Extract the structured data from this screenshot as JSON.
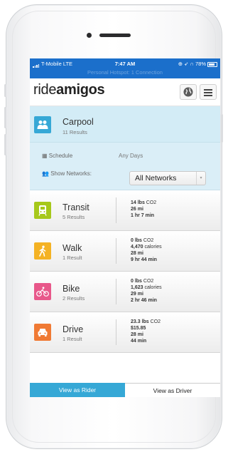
{
  "status_bar": {
    "carrier": "T-Mobile",
    "network": "LTE",
    "time": "7:47 AM",
    "battery": "78%",
    "hotspot": "Personal Hotspot: 1 Connection"
  },
  "header": {
    "logo_light": "ride",
    "logo_bold": "amigos"
  },
  "carpool": {
    "title": "Carpool",
    "results": "11 Results",
    "color": "#36a8d6"
  },
  "options": {
    "schedule_label": "Schedule",
    "schedule_value": "Any Days",
    "networks_label": "Show Networks:",
    "networks_selected": "All Networks"
  },
  "modes": [
    {
      "title": "Transit",
      "results": "5 Results",
      "color": "#a6c81a",
      "icon": "bus-icon",
      "stats": [
        {
          "bold": "14 lbs",
          "rest": " CO2"
        },
        {
          "bold": "26 mi",
          "rest": ""
        },
        {
          "bold": "1 hr 7 min",
          "rest": ""
        }
      ]
    },
    {
      "title": "Walk",
      "results": "1 Result",
      "color": "#f4b223",
      "icon": "walk-icon",
      "stats": [
        {
          "bold": "0 lbs",
          "rest": " CO2"
        },
        {
          "bold": "4,470",
          "rest": " calories"
        },
        {
          "bold": "28 mi",
          "rest": ""
        },
        {
          "bold": "9 hr 44 min",
          "rest": ""
        }
      ]
    },
    {
      "title": "Bike",
      "results": "2 Results",
      "color": "#e8588a",
      "icon": "bike-icon",
      "stats": [
        {
          "bold": "0 lbs",
          "rest": " CO2"
        },
        {
          "bold": "1,623",
          "rest": " calories"
        },
        {
          "bold": "29 mi",
          "rest": ""
        },
        {
          "bold": "2 hr 46 min",
          "rest": ""
        }
      ]
    },
    {
      "title": "Drive",
      "results": "1 Result",
      "color": "#f07a34",
      "icon": "car-icon",
      "stats": [
        {
          "bold": "23.3 lbs",
          "rest": " CO2"
        },
        {
          "bold": "$15.85",
          "rest": ""
        },
        {
          "bold": "28 mi",
          "rest": ""
        },
        {
          "bold": "44 min",
          "rest": ""
        }
      ]
    }
  ],
  "footer": {
    "rider_label": "View as Rider",
    "driver_label": "View as Driver"
  }
}
